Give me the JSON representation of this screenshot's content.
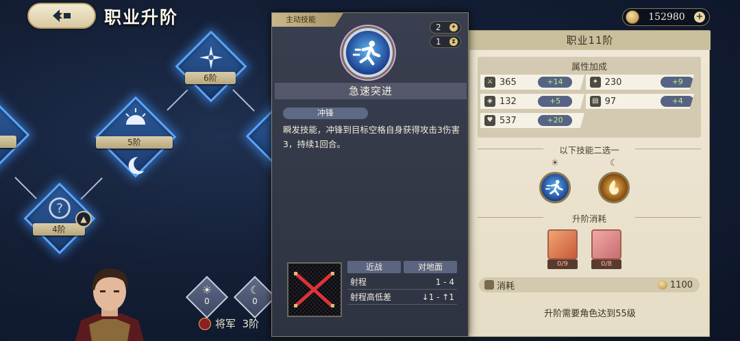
{
  "header": {
    "title": "职业升阶",
    "currency_value": "152980",
    "plus_symbol": "+"
  },
  "tree": {
    "nodes": [
      {
        "label": "6阶"
      },
      {
        "label": "5阶"
      },
      {
        "label": "4阶"
      }
    ]
  },
  "hero": {
    "caption": "将军  3阶",
    "slots": [
      {
        "count": "0"
      },
      {
        "count": "0"
      }
    ]
  },
  "skill": {
    "tag": "主动技能",
    "cost_a": "2",
    "cost_b": "1",
    "name": "急速突进",
    "type_pill": "冲锋",
    "description": "瞬发技能，冲锋到目标空格自身获得攻击3伤害3，持续1回合。",
    "range_headers": [
      "近战",
      "对地面"
    ],
    "range_rows": [
      {
        "label": "射程",
        "value": "1 - 4"
      },
      {
        "label": "射程高低差",
        "value": "↓1 - ↑1"
      }
    ]
  },
  "info": {
    "title": "职业11阶",
    "attr_title": "属性加成",
    "attrs": [
      {
        "icon": "sword-icon",
        "value": "365",
        "bonus": "+14"
      },
      {
        "icon": "wand-icon",
        "value": "230",
        "bonus": "+9"
      },
      {
        "icon": "shield-icon",
        "value": "132",
        "bonus": "+5"
      },
      {
        "icon": "book-icon",
        "value": "97",
        "bonus": "+4"
      },
      {
        "icon": "heart-icon",
        "value": "537",
        "bonus": "+20"
      }
    ],
    "choice_title": "以下技能二选一",
    "material_title": "升阶消耗",
    "materials": [
      {
        "count": "0/9",
        "color": "#c65a38"
      },
      {
        "count": "0/8",
        "color": "#c76e72"
      }
    ],
    "cost_label": "消耗",
    "cost_value": "1100",
    "requirement": "升阶需要角色达到55级"
  },
  "colors": {
    "node_glow": "#5aa6ff",
    "panel_bg": "#efe8d6",
    "bonus_text": "#bff07a"
  }
}
